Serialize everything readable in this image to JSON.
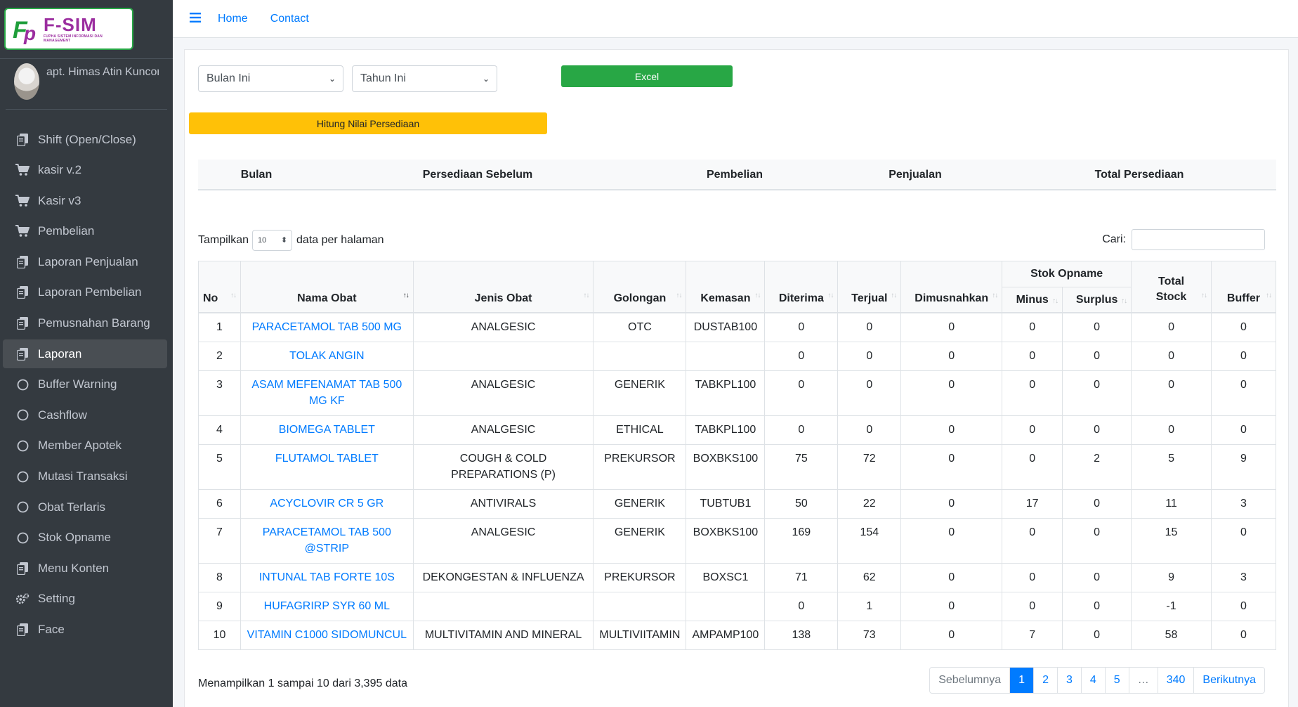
{
  "brand": {
    "title": "F-SIM",
    "subtitle": "FUPHA SISTEM INFORMASI DAN MANAGEMENT"
  },
  "user": {
    "name": "apt. Himas Atin Kuncorowati"
  },
  "sidebar": {
    "items": [
      {
        "label": "Shift (Open/Close)",
        "icon": "copy-icon"
      },
      {
        "label": "kasir v.2",
        "icon": "cart-icon"
      },
      {
        "label": "Kasir v3",
        "icon": "cart-icon"
      },
      {
        "label": "Pembelian",
        "icon": "cart-icon"
      },
      {
        "label": "Laporan Penjualan",
        "icon": "copy-icon"
      },
      {
        "label": "Laporan Pembelian",
        "icon": "copy-icon"
      },
      {
        "label": "Pemusnahan Barang",
        "icon": "copy-icon"
      },
      {
        "label": "Laporan",
        "icon": "copy-icon",
        "active": true
      },
      {
        "label": "Buffer Warning",
        "icon": "circle-icon"
      },
      {
        "label": "Cashflow",
        "icon": "circle-icon"
      },
      {
        "label": "Member Apotek",
        "icon": "circle-icon"
      },
      {
        "label": "Mutasi Transaksi",
        "icon": "circle-icon"
      },
      {
        "label": "Obat Terlaris",
        "icon": "circle-icon"
      },
      {
        "label": "Stok Opname",
        "icon": "circle-icon"
      },
      {
        "label": "Menu Konten",
        "icon": "copy-icon"
      },
      {
        "label": "Setting",
        "icon": "gears-icon"
      },
      {
        "label": "Face",
        "icon": "copy-icon"
      }
    ]
  },
  "topbar": {
    "home": "Home",
    "contact": "Contact"
  },
  "filters": {
    "month": "Bulan Ini",
    "year": "Tahun Ini",
    "excel": "Excel",
    "hitung": "Hitung Nilai Persediaan"
  },
  "summary": {
    "headers": [
      "Bulan",
      "Persediaan Sebelum",
      "Pembelian",
      "Penjualan",
      "Total Persediaan"
    ]
  },
  "table": {
    "length_prefix": "Tampilkan",
    "length_value": "10",
    "length_suffix": "data per halaman",
    "search_label": "Cari:",
    "headers": {
      "no": "No",
      "nama": "Nama Obat",
      "jenis": "Jenis Obat",
      "golongan": "Golongan",
      "kemasan": "Kemasan",
      "diterima": "Diterima",
      "terjual": "Terjual",
      "dimusnahkan": "Dimusnahkan",
      "stok_opname": "Stok Opname",
      "minus": "Minus",
      "surplus": "Surplus",
      "total_stock": "Total Stock",
      "buffer": "Buffer"
    },
    "rows": [
      {
        "no": "1",
        "nama": "PARACETAMOL TAB 500 MG",
        "jenis": "ANALGESIC",
        "golongan": "OTC",
        "kemasan": "DUSTAB100",
        "diterima": "0",
        "terjual": "0",
        "dimusnahkan": "0",
        "minus": "0",
        "surplus": "0",
        "total": "0",
        "buffer": "0"
      },
      {
        "no": "2",
        "nama": "TOLAK ANGIN",
        "jenis": "",
        "golongan": "",
        "kemasan": "",
        "diterima": "0",
        "terjual": "0",
        "dimusnahkan": "0",
        "minus": "0",
        "surplus": "0",
        "total": "0",
        "buffer": "0"
      },
      {
        "no": "3",
        "nama": "ASAM MEFENAMAT TAB 500 MG KF",
        "jenis": "ANALGESIC",
        "golongan": "GENERIK",
        "kemasan": "TABKPL100",
        "diterima": "0",
        "terjual": "0",
        "dimusnahkan": "0",
        "minus": "0",
        "surplus": "0",
        "total": "0",
        "buffer": "0"
      },
      {
        "no": "4",
        "nama": "BIOMEGA TABLET",
        "jenis": "ANALGESIC",
        "golongan": "ETHICAL",
        "kemasan": "TABKPL100",
        "diterima": "0",
        "terjual": "0",
        "dimusnahkan": "0",
        "minus": "0",
        "surplus": "0",
        "total": "0",
        "buffer": "0"
      },
      {
        "no": "5",
        "nama": "FLUTAMOL TABLET",
        "jenis": "COUGH & COLD PREPARATIONS (P)",
        "golongan": "PREKURSOR",
        "kemasan": "BOXBKS100",
        "diterima": "75",
        "terjual": "72",
        "dimusnahkan": "0",
        "minus": "0",
        "surplus": "2",
        "total": "5",
        "buffer": "9"
      },
      {
        "no": "6",
        "nama": "ACYCLOVIR CR 5 GR",
        "jenis": "ANTIVIRALS",
        "golongan": "GENERIK",
        "kemasan": "TUBTUB1",
        "diterima": "50",
        "terjual": "22",
        "dimusnahkan": "0",
        "minus": "17",
        "surplus": "0",
        "total": "11",
        "buffer": "3"
      },
      {
        "no": "7",
        "nama": "PARACETAMOL TAB 500 @STRIP",
        "jenis": "ANALGESIC",
        "golongan": "GENERIK",
        "kemasan": "BOXBKS100",
        "diterima": "169",
        "terjual": "154",
        "dimusnahkan": "0",
        "minus": "0",
        "surplus": "0",
        "total": "15",
        "buffer": "0"
      },
      {
        "no": "8",
        "nama": "INTUNAL TAB FORTE 10S",
        "jenis": "DEKONGESTAN & INFLUENZA",
        "golongan": "PREKURSOR",
        "kemasan": "BOXSC1",
        "diterima": "71",
        "terjual": "62",
        "dimusnahkan": "0",
        "minus": "0",
        "surplus": "0",
        "total": "9",
        "buffer": "3"
      },
      {
        "no": "9",
        "nama": "HUFAGRIRP SYR 60 ML",
        "jenis": "",
        "golongan": "",
        "kemasan": "",
        "diterima": "0",
        "terjual": "1",
        "dimusnahkan": "0",
        "minus": "0",
        "surplus": "0",
        "total": "-1",
        "buffer": "0"
      },
      {
        "no": "10",
        "nama": "VITAMIN C1000 SIDOMUNCUL",
        "jenis": "MULTIVITAMIN AND MINERAL",
        "golongan": "MULTIVIITAMIN",
        "kemasan": "AMPAMP100",
        "diterima": "138",
        "terjual": "73",
        "dimusnahkan": "0",
        "minus": "7",
        "surplus": "0",
        "total": "58",
        "buffer": "0"
      }
    ],
    "info": "Menampilkan 1 sampai 10 dari 3,395 data"
  },
  "pagination": {
    "prev": "Sebelumnya",
    "pages": [
      "1",
      "2",
      "3",
      "4",
      "5",
      "…",
      "340"
    ],
    "active": "1",
    "next": "Berikutnya"
  }
}
